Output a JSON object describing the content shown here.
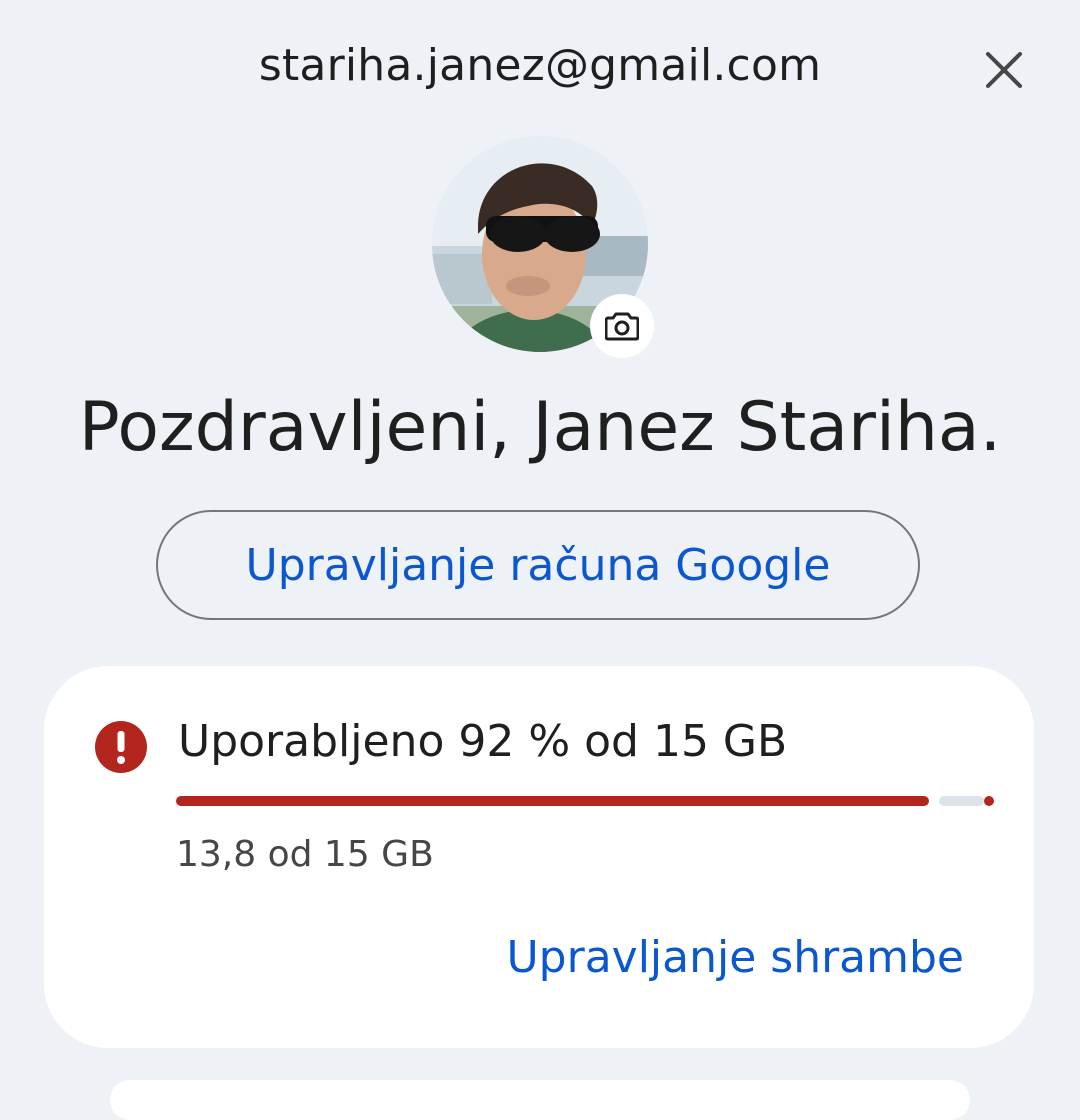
{
  "account": {
    "email": "stariha.janez@gmail.com"
  },
  "greeting": "Pozdravljeni, Janez Stariha.",
  "manage_account_label": "Upravljanje računa Google",
  "storage": {
    "title": "Uporabljeno 92 % od 15 GB",
    "used_fraction": 0.92,
    "detail": "13,8 od 15 GB",
    "manage_label": "Upravljanje shrambe",
    "alert_color": "#b3261e"
  },
  "icons": {
    "close": "close-icon",
    "camera": "camera-icon",
    "alert": "error-icon"
  },
  "colors": {
    "background": "#eef2f7",
    "link": "#0b57d0",
    "warning": "#b3261e"
  }
}
